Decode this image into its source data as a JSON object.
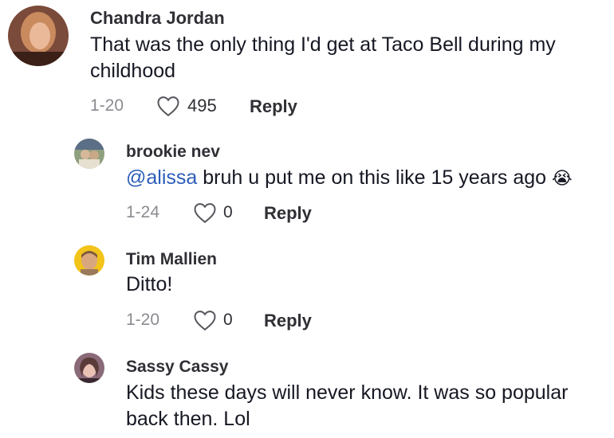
{
  "comments": [
    {
      "author": "Chandra Jordan",
      "text": "That was the only thing I'd get at Taco Bell during my childhood",
      "date": "1-20",
      "likes": "495",
      "reply_label": "Reply",
      "avatar_colors": [
        "#6b3a2a",
        "#e7b79a",
        "#d28a5e"
      ]
    },
    {
      "author": "brookie nev",
      "mention": "@alissa",
      "text": " bruh u put me on this like 15 years ago",
      "emoji": "😭",
      "date": "1-24",
      "likes": "0",
      "reply_label": "Reply",
      "avatar_colors": [
        "#7a8c6e",
        "#c9b89a",
        "#4d5f7a"
      ]
    },
    {
      "author": "Tim Mallien",
      "text": "Ditto!",
      "date": "1-20",
      "likes": "0",
      "reply_label": "Reply",
      "avatar_colors": [
        "#f2c318",
        "#d9a77e",
        "#7e5a3f"
      ]
    },
    {
      "author": "Sassy Cassy",
      "text": "Kids these days will never know. It was so popular back then. Lol",
      "avatar_colors": [
        "#8a6a78",
        "#e9c2b4",
        "#5b3a3a"
      ]
    }
  ],
  "colors": {
    "mention": "#2b5db9",
    "meta": "#8a8b91",
    "text": "#161823"
  }
}
